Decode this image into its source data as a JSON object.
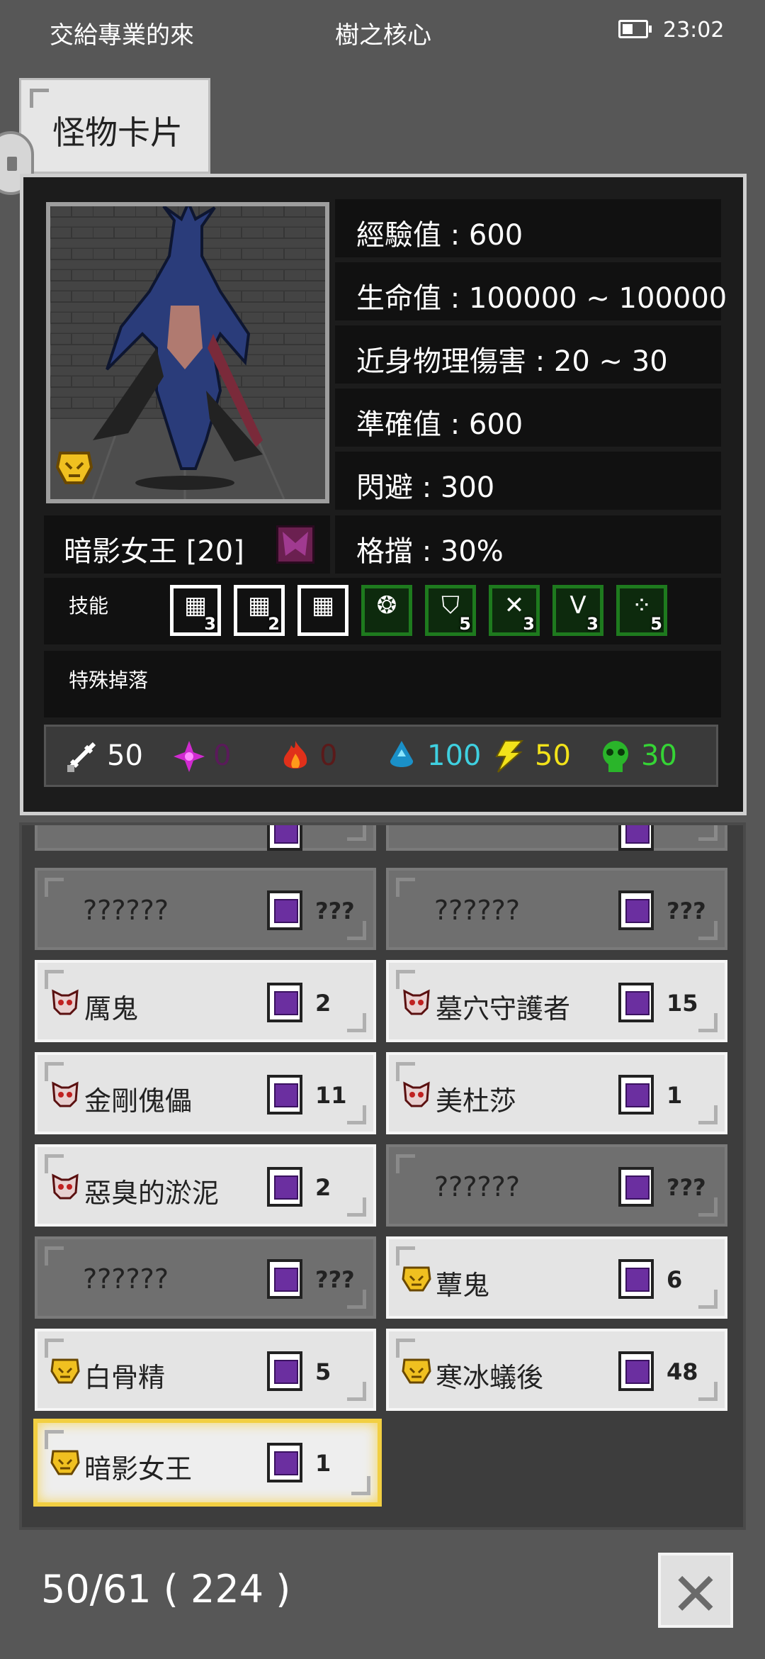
{
  "status_bar": {
    "left_text": "交給專業的來",
    "center_text": "樹之核心",
    "time": "23:02"
  },
  "tab": {
    "label": "怪物卡片"
  },
  "monster": {
    "name": "暗影女王 [20]",
    "stats": {
      "exp": "經驗值 : 600",
      "hp": "生命值 : 100000 ~ 100000",
      "melee": "近身物理傷害 : 20 ~ 30",
      "accuracy": "準確值 : 600",
      "evade": "閃避 : 300",
      "block": "格擋 : 30%"
    },
    "skills_label": "技能",
    "skills": [
      {
        "icon": "rune-skill-icon",
        "count": "3",
        "style": "white"
      },
      {
        "icon": "rune-skill-icon",
        "count": "2",
        "style": "white"
      },
      {
        "icon": "rune-skill-icon",
        "count": "",
        "style": "white"
      },
      {
        "icon": "wing-skill-icon",
        "count": "",
        "style": "green"
      },
      {
        "icon": "shield-skill-icon",
        "count": "5",
        "style": "green"
      },
      {
        "icon": "crossed-swords-skill-icon",
        "count": "3",
        "style": "green"
      },
      {
        "icon": "v-skill-icon",
        "count": "3",
        "style": "green"
      },
      {
        "icon": "dots-skill-icon",
        "count": "5",
        "style": "green"
      }
    ],
    "special_drop_label": "特殊掉落",
    "resistances": {
      "physical": "50",
      "arcane": "0",
      "fire": "0",
      "water": "100",
      "lightning": "50",
      "poison": "30"
    }
  },
  "cards": [
    {
      "name": "??????",
      "count": "???",
      "state": "unknown",
      "col": 0,
      "row": 0,
      "tier": ""
    },
    {
      "name": "??????",
      "count": "???",
      "state": "unknown",
      "col": 1,
      "row": 0,
      "tier": ""
    },
    {
      "name": "厲鬼",
      "count": "2",
      "state": "known",
      "col": 0,
      "row": 1,
      "tier": "red"
    },
    {
      "name": "墓穴守護者",
      "count": "15",
      "state": "known",
      "col": 1,
      "row": 1,
      "tier": "red"
    },
    {
      "name": "金剛傀儡",
      "count": "11",
      "state": "known",
      "col": 0,
      "row": 2,
      "tier": "red"
    },
    {
      "name": "美杜莎",
      "count": "1",
      "state": "known",
      "col": 1,
      "row": 2,
      "tier": "red"
    },
    {
      "name": "惡臭的淤泥",
      "count": "2",
      "state": "known",
      "col": 0,
      "row": 3,
      "tier": "red"
    },
    {
      "name": "??????",
      "count": "???",
      "state": "unknown",
      "col": 1,
      "row": 3,
      "tier": ""
    },
    {
      "name": "??????",
      "count": "???",
      "state": "unknown",
      "col": 0,
      "row": 4,
      "tier": ""
    },
    {
      "name": "蕈鬼",
      "count": "6",
      "state": "known",
      "col": 1,
      "row": 4,
      "tier": "gold"
    },
    {
      "name": "白骨精",
      "count": "5",
      "state": "known",
      "col": 0,
      "row": 5,
      "tier": "gold"
    },
    {
      "name": "寒冰蟻後",
      "count": "48",
      "state": "known",
      "col": 1,
      "row": 5,
      "tier": "gold"
    },
    {
      "name": "暗影女王",
      "count": "1",
      "state": "selected",
      "col": 0,
      "row": 6,
      "tier": "gold"
    }
  ],
  "footer": {
    "collection": "50/61 ( 224 )"
  },
  "colors": {
    "water": "#3fd0e0",
    "lightning": "#f2e21a",
    "poison": "#35d435",
    "arcane": "#5a1a5a",
    "fire": "#5a1a1a",
    "selected_border": "#f2cf42"
  }
}
